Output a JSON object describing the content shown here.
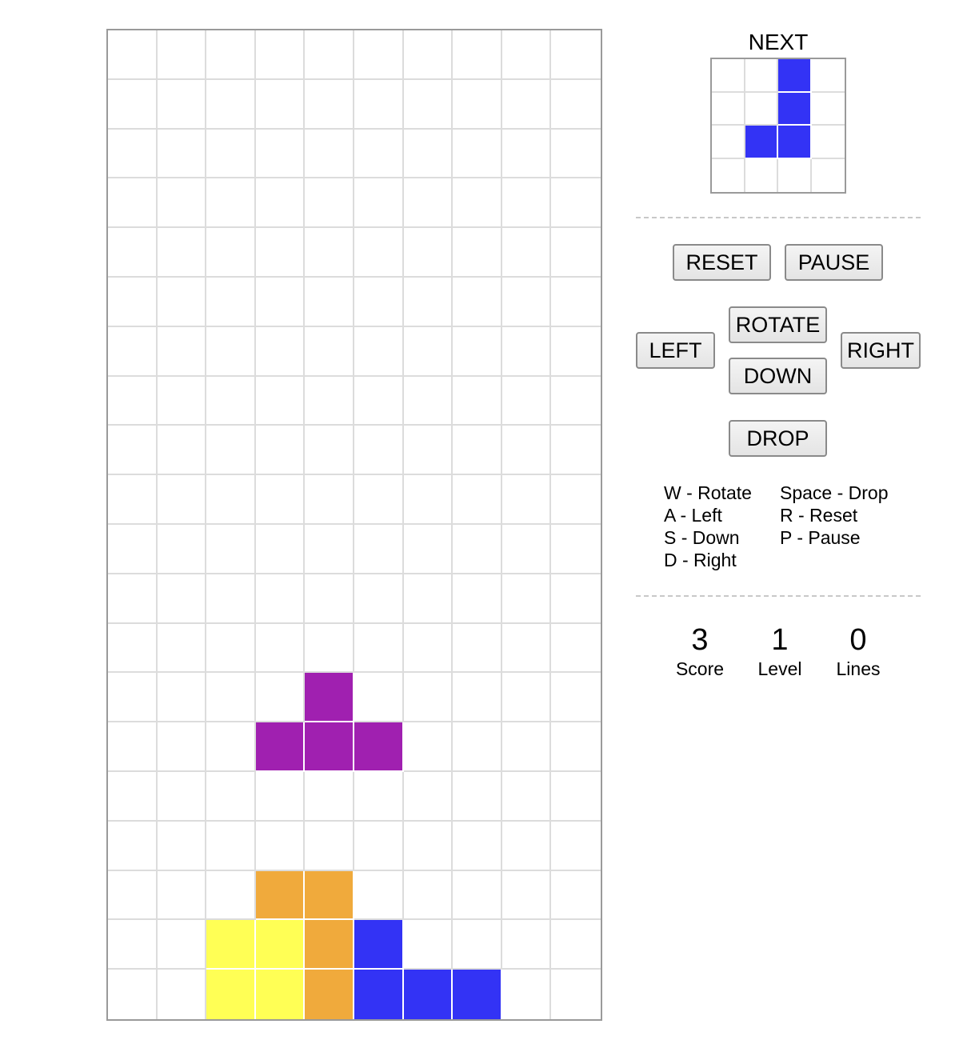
{
  "board": {
    "cols": 10,
    "rows": 20,
    "colors": {
      "T": "#a020b0",
      "O": "#ffff55",
      "L": "#f0aa3c",
      "J": "#3333f5"
    },
    "blocks": [
      {
        "row": 13,
        "col": 4,
        "piece": "T"
      },
      {
        "row": 14,
        "col": 3,
        "piece": "T"
      },
      {
        "row": 14,
        "col": 4,
        "piece": "T"
      },
      {
        "row": 14,
        "col": 5,
        "piece": "T"
      },
      {
        "row": 17,
        "col": 3,
        "piece": "L"
      },
      {
        "row": 17,
        "col": 4,
        "piece": "L"
      },
      {
        "row": 18,
        "col": 4,
        "piece": "L"
      },
      {
        "row": 19,
        "col": 4,
        "piece": "L"
      },
      {
        "row": 18,
        "col": 2,
        "piece": "O"
      },
      {
        "row": 18,
        "col": 3,
        "piece": "O"
      },
      {
        "row": 19,
        "col": 2,
        "piece": "O"
      },
      {
        "row": 19,
        "col": 3,
        "piece": "O"
      },
      {
        "row": 18,
        "col": 5,
        "piece": "J"
      },
      {
        "row": 19,
        "col": 5,
        "piece": "J"
      },
      {
        "row": 19,
        "col": 6,
        "piece": "J"
      },
      {
        "row": 19,
        "col": 7,
        "piece": "J"
      }
    ]
  },
  "next": {
    "label": "NEXT",
    "size": 4,
    "color": "#3333f5",
    "blocks": [
      {
        "row": 0,
        "col": 2
      },
      {
        "row": 1,
        "col": 2
      },
      {
        "row": 2,
        "col": 1
      },
      {
        "row": 2,
        "col": 2
      }
    ]
  },
  "controls": {
    "reset": "RESET",
    "pause": "PAUSE",
    "left": "LEFT",
    "rotate": "ROTATE",
    "down": "DOWN",
    "right": "RIGHT",
    "drop": "DROP"
  },
  "keys": {
    "left_column": [
      "W - Rotate",
      "A - Left",
      "S - Down",
      "D - Right"
    ],
    "right_column": [
      "Space - Drop",
      "R - Reset",
      "P - Pause"
    ]
  },
  "stats": {
    "score_value": "3",
    "score_label": "Score",
    "level_value": "1",
    "level_label": "Level",
    "lines_value": "0",
    "lines_label": "Lines"
  }
}
